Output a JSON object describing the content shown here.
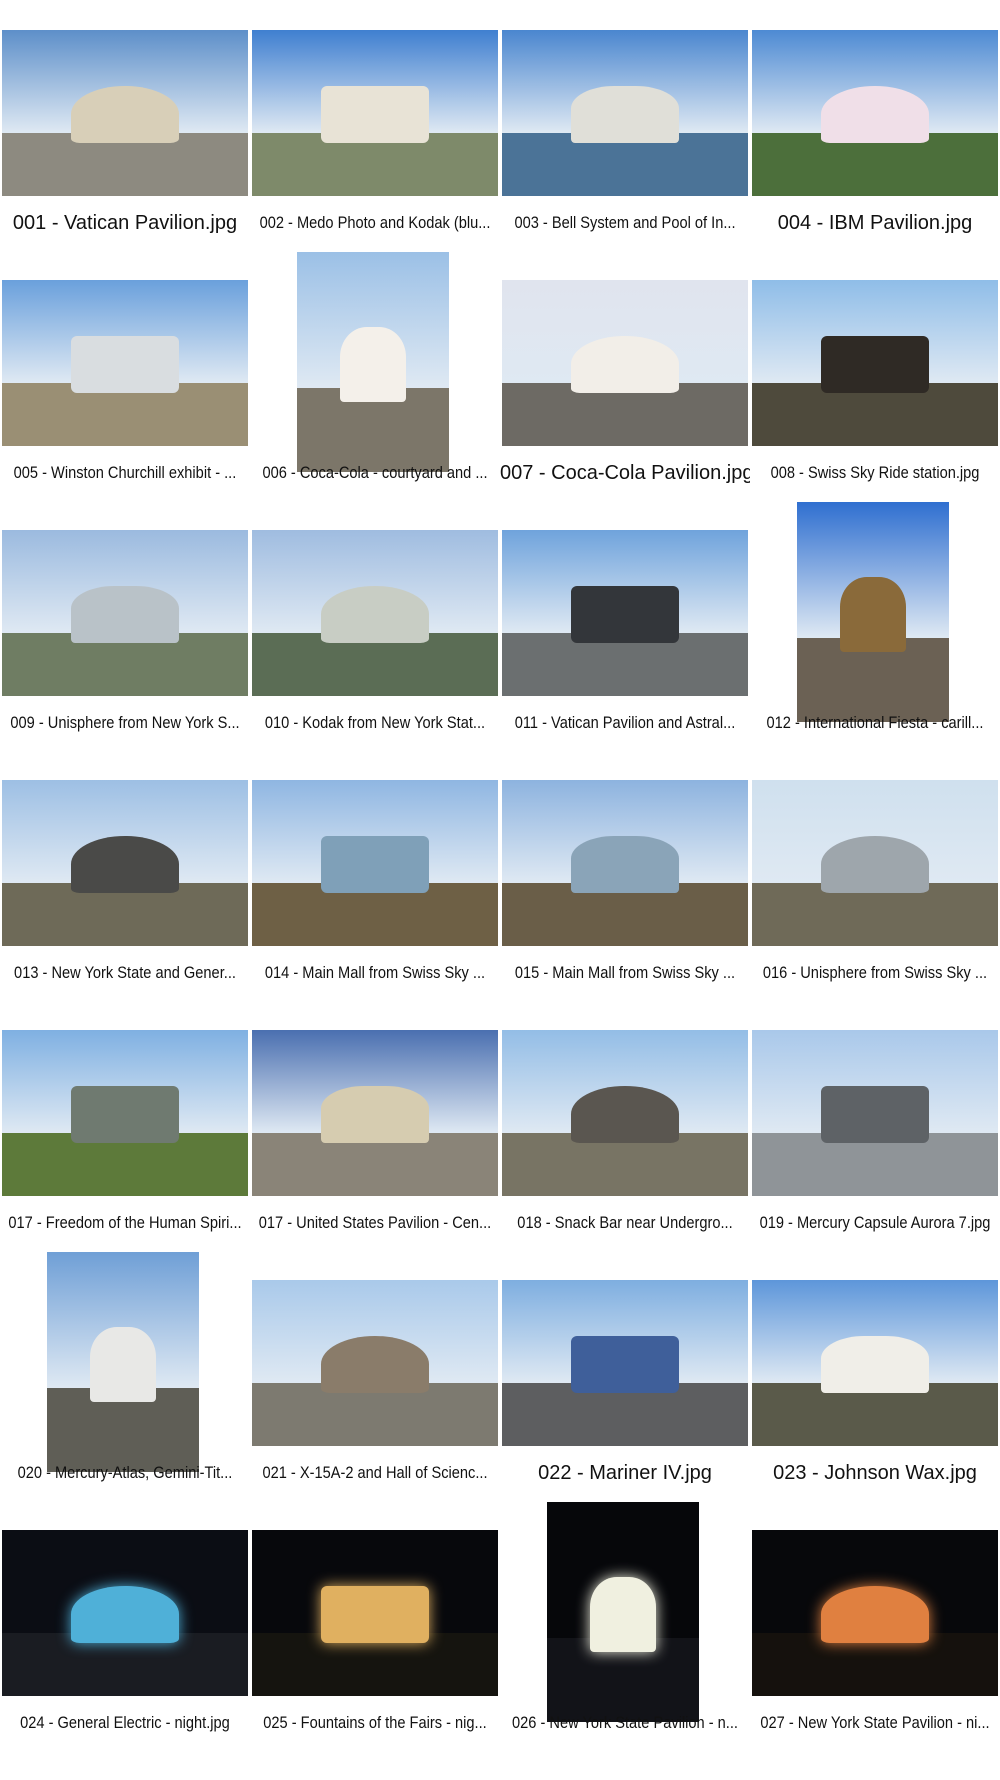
{
  "images": [
    {
      "filename": "001 - Vatican Pavilion.jpg",
      "orientation": "land",
      "sky": "#5d8fc9",
      "ground": "#8d8a80",
      "subject": "#d8cfb8",
      "night": false,
      "big": true
    },
    {
      "filename": "002 - Medo Photo and Kodak (blu...",
      "orientation": "land",
      "sky": "#3f7fd0",
      "ground": "#7e8a6a",
      "subject": "#e8e3d6",
      "night": false,
      "big": false
    },
    {
      "filename": "003 - Bell System and Pool of In...",
      "orientation": "land",
      "sky": "#4a86cf",
      "ground": "#4b7397",
      "subject": "#e0dfd8",
      "night": false,
      "big": false
    },
    {
      "filename": "004 - IBM Pavilion.jpg",
      "orientation": "land",
      "sky": "#4d8ad3",
      "ground": "#4c6f3b",
      "subject": "#f0dfe8",
      "night": false,
      "big": true
    },
    {
      "filename": "005 - Winston Churchill exhibit - ...",
      "orientation": "land",
      "sky": "#6aa0dc",
      "ground": "#9a8f74",
      "subject": "#d9dde0",
      "night": false,
      "big": false
    },
    {
      "filename": "006 - Coca-Cola - courtyard and ...",
      "orientation": "port",
      "sky": "#9bc0e6",
      "ground": "#7c7669",
      "subject": "#f4f0ea",
      "night": false,
      "big": false
    },
    {
      "filename": "007 - Coca-Cola Pavilion.jpg",
      "orientation": "land",
      "sky": "#e0e4ee",
      "ground": "#6d6a64",
      "subject": "#f2eee8",
      "night": false,
      "big": true
    },
    {
      "filename": "008 - Swiss Sky Ride station.jpg",
      "orientation": "land",
      "sky": "#8fbde8",
      "ground": "#4e4a3c",
      "subject": "#2f2a25",
      "night": false,
      "big": false
    },
    {
      "filename": "009 - Unisphere from New York S...",
      "orientation": "land",
      "sky": "#9bbadf",
      "ground": "#6f7d63",
      "subject": "#b9c2c8",
      "night": false,
      "big": false
    },
    {
      "filename": "010 - Kodak from New York Stat...",
      "orientation": "land",
      "sky": "#9fbce0",
      "ground": "#5b6d55",
      "subject": "#c8cdc4",
      "night": false,
      "big": false
    },
    {
      "filename": "011 - Vatican Pavilion and Astral...",
      "orientation": "land",
      "sky": "#6fa3dc",
      "ground": "#6b6f70",
      "subject": "#33363a",
      "night": false,
      "big": false
    },
    {
      "filename": "012 - International Fiesta - carill...",
      "orientation": "port",
      "sky": "#2f6fd0",
      "ground": "#6b6154",
      "subject": "#8a6a3a",
      "night": false,
      "big": false
    },
    {
      "filename": "013 - New York State and Gener...",
      "orientation": "land",
      "sky": "#9dbfe4",
      "ground": "#6e6a58",
      "subject": "#4a4a48",
      "night": false,
      "big": false
    },
    {
      "filename": "014 - Main Mall from Swiss Sky ...",
      "orientation": "land",
      "sky": "#8fb6e2",
      "ground": "#6e6045",
      "subject": "#7fa0b8",
      "night": false,
      "big": false
    },
    {
      "filename": "015 - Main Mall from Swiss Sky ...",
      "orientation": "land",
      "sky": "#8db3df",
      "ground": "#6a5e48",
      "subject": "#8aa4b8",
      "night": false,
      "big": false
    },
    {
      "filename": "016 - Unisphere from Swiss Sky ...",
      "orientation": "land",
      "sky": "#cfe0ee",
      "ground": "#6f6a58",
      "subject": "#9ea6ac",
      "night": false,
      "big": false
    },
    {
      "filename": "017 - Freedom of the Human Spiri...",
      "orientation": "land",
      "sky": "#7fb0e2",
      "ground": "#5d7a3a",
      "subject": "#6f7a70",
      "night": false,
      "big": false
    },
    {
      "filename": "017 - United States Pavilion - Cen...",
      "orientation": "land",
      "sky": "#4a6fb0",
      "ground": "#8a8478",
      "subject": "#d6ccb0",
      "night": false,
      "big": false
    },
    {
      "filename": "018 - Snack Bar near Undergro...",
      "orientation": "land",
      "sky": "#93bde6",
      "ground": "#787464",
      "subject": "#5a5650",
      "night": false,
      "big": false
    },
    {
      "filename": "019 - Mercury Capsule Aurora 7.jpg",
      "orientation": "land",
      "sky": "#a9c8ea",
      "ground": "#8f9498",
      "subject": "#5e6266",
      "night": false,
      "big": false
    },
    {
      "filename": "020 - Mercury-Atlas, Gemini-Tit...",
      "orientation": "port",
      "sky": "#6f9fd6",
      "ground": "#5f5e56",
      "subject": "#e8e8e6",
      "night": false,
      "big": false
    },
    {
      "filename": "021 - X-15A-2 and Hall of Scienc...",
      "orientation": "land",
      "sky": "#a9c9ea",
      "ground": "#7d7a70",
      "subject": "#8a7c6a",
      "night": false,
      "big": false
    },
    {
      "filename": "022 - Mariner IV.jpg",
      "orientation": "land",
      "sky": "#7eaee0",
      "ground": "#5d5e60",
      "subject": "#3f5f9a",
      "night": false,
      "big": true
    },
    {
      "filename": "023 - Johnson Wax.jpg",
      "orientation": "land",
      "sky": "#5d96da",
      "ground": "#5a5a4a",
      "subject": "#f0eee8",
      "night": false,
      "big": true
    },
    {
      "filename": "024 - General Electric - night.jpg",
      "orientation": "land",
      "sky": "#0b0d14",
      "ground": "#1a1c22",
      "subject": "#4fb0d8",
      "night": true,
      "big": false
    },
    {
      "filename": "025 - Fountains of the Fairs - nig...",
      "orientation": "land",
      "sky": "#07080c",
      "ground": "#15140f",
      "subject": "#e0b060",
      "night": true,
      "big": false
    },
    {
      "filename": "026 - New York State Pavilion - n...",
      "orientation": "port",
      "sky": "#06070a",
      "ground": "#121318",
      "subject": "#f0f0e0",
      "night": true,
      "big": false
    },
    {
      "filename": "027 - New York State Pavilion - ni...",
      "orientation": "land",
      "sky": "#07080b",
      "ground": "#15110d",
      "subject": "#e08040",
      "night": true,
      "big": false
    }
  ]
}
